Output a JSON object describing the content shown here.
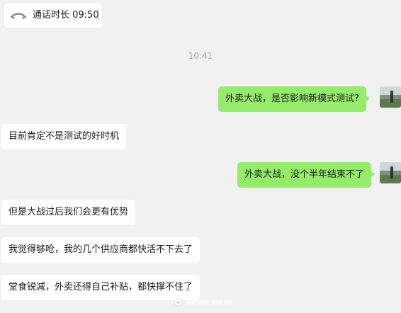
{
  "call_record": {
    "icon": "phone-hangup-icon",
    "label": "通话时长 09:50"
  },
  "timestamp": "10:41",
  "messages": [
    {
      "side": "right",
      "text": "外卖大战，是否影响新模式测试?"
    },
    {
      "side": "left",
      "text": "目前肯定不是测试的好时机"
    },
    {
      "side": "right",
      "text": "外卖大战，没个半年结束不了"
    },
    {
      "side": "left",
      "text": "但是大战过后我们会更有优势"
    },
    {
      "side": "left",
      "text": "我觉得够呛，我的几个供应商都快活不下去了"
    },
    {
      "side": "left",
      "text": "堂食锐减，外卖还得自己补贴，都快撑不住了"
    }
  ],
  "colors": {
    "background": "#f1f1f1",
    "incoming_bubble": "#ffffff",
    "outgoing_bubble": "#95ec69",
    "timestamp_text": "#a8a8a8"
  }
}
